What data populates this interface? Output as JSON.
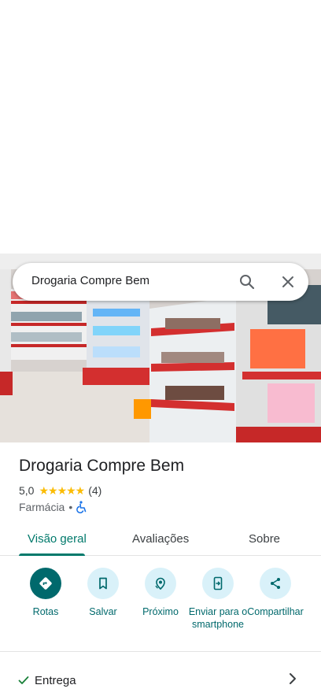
{
  "search": {
    "query": "Drogaria Compre Bem"
  },
  "place": {
    "name": "Drogaria Compre Bem",
    "rating": "5,0",
    "stars": "★★★★★",
    "review_count": "(4)",
    "category": "Farmácia",
    "separator": "•"
  },
  "tabs": [
    {
      "label": "Visão geral",
      "active": true
    },
    {
      "label": "Avaliações",
      "active": false
    },
    {
      "label": "Sobre",
      "active": false
    }
  ],
  "actions": [
    {
      "label": "Rotas",
      "icon": "directions-icon"
    },
    {
      "label": "Salvar",
      "icon": "bookmark-icon"
    },
    {
      "label": "Próximo",
      "icon": "nearby-icon"
    },
    {
      "label": "Enviar para o smartphone",
      "icon": "send-to-phone-icon"
    },
    {
      "label": "Compartilhar",
      "icon": "share-icon"
    }
  ],
  "details": {
    "entrega": "Entrega"
  },
  "colors": {
    "accent": "#00796b",
    "action_bg": "#d9f1f9",
    "star": "#fbbc04"
  }
}
